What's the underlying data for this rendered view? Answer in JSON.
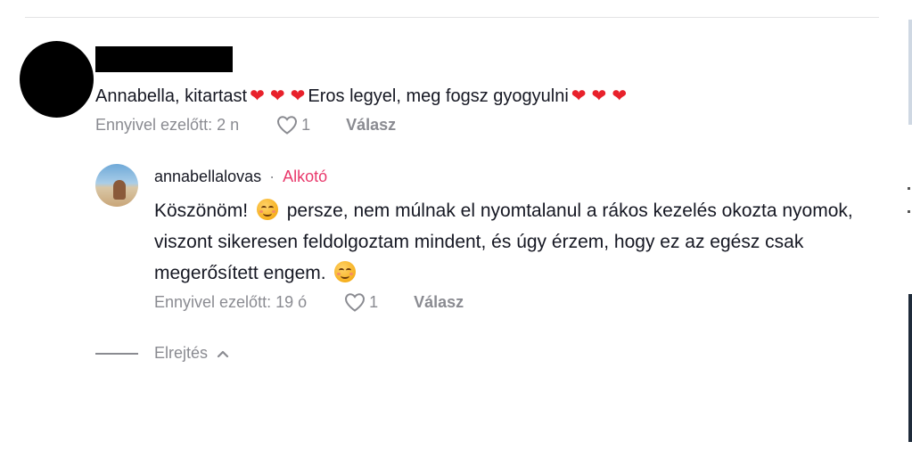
{
  "comment": {
    "text_part1": "Annabella, kitartast",
    "text_part2": "Eros legyel, meg fogsz gyogyulni",
    "heart_glyph": "❤",
    "time": "Ennyivel ezelőtt: 2 n",
    "likes": "1",
    "reply_label": "Válasz"
  },
  "reply": {
    "username": "annabellalovas",
    "separator": "·",
    "badge": "Alkotó",
    "text_part1": "Köszönöm!",
    "text_part2": "persze, nem múlnak el nyomtalanul a rákos kezelés okozta nyomok, viszont sikeresen feldolgoztam mindent, és úgy érzem, hogy ez az egész csak megerősített engem.",
    "time": "Ennyivel ezelőtt: 19 ó",
    "likes": "1",
    "reply_label": "Válasz"
  },
  "collapse": {
    "label": "Elrejtés"
  },
  "colors": {
    "heart": "#e8212b",
    "creator_badge": "#e9386b",
    "muted": "#8a8b91"
  },
  "icons": {
    "like": "heart-outline-icon",
    "collapse": "chevron-up-icon",
    "emoji": "smiling-face-icon"
  }
}
